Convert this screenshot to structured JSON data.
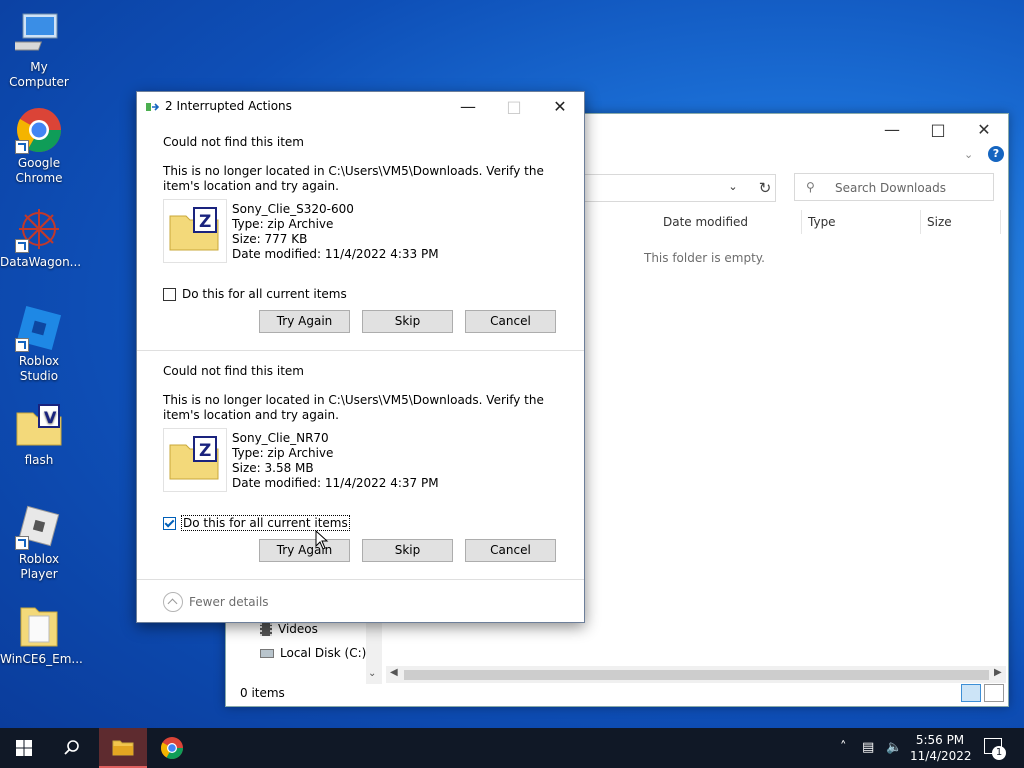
{
  "desktop": {
    "icons": [
      {
        "label": "My Computer"
      },
      {
        "label": "Google Chrome"
      },
      {
        "label": "DataWagon..."
      },
      {
        "label": "Roblox Studio"
      },
      {
        "label": "flash"
      },
      {
        "label": "Roblox Player"
      },
      {
        "label": "WinCE6_Em..."
      }
    ]
  },
  "explorer": {
    "search_placeholder": "Search Downloads",
    "columns": [
      "Date modified",
      "Type",
      "Size"
    ],
    "empty_message": "This folder is empty.",
    "nav_items": [
      "Videos",
      "Local Disk (C:)"
    ],
    "status": "0 items"
  },
  "dialog": {
    "title": "2 Interrupted Actions",
    "items": [
      {
        "heading": "Could not find this item",
        "message": "This is no longer located in C:\\Users\\VM5\\Downloads. Verify the item's location and try again.",
        "file_name": "Sony_Clie_S320-600",
        "file_type": "Type: zip Archive",
        "file_size": "Size: 777 KB",
        "file_date": "Date modified: 11/4/2022 4:33 PM",
        "checkbox_label": "Do this for all current items",
        "checked": false
      },
      {
        "heading": "Could not find this item",
        "message": "This is no longer located in C:\\Users\\VM5\\Downloads. Verify the item's location and try again.",
        "file_name": "Sony_Clie_NR70",
        "file_type": "Type: zip Archive",
        "file_size": "Size: 3.58 MB",
        "file_date": "Date modified: 11/4/2022 4:37 PM",
        "checkbox_label": "Do this for all current items",
        "checked": true
      }
    ],
    "buttons": {
      "try_again": "Try Again",
      "skip": "Skip",
      "cancel": "Cancel"
    },
    "fewer_details": "Fewer details"
  },
  "taskbar": {
    "time": "5:56 PM",
    "date": "11/4/2022",
    "notification_count": "1"
  },
  "colors": {
    "accent": "#005fb8",
    "taskbar": "#101826",
    "desktop": "#1b6fd6"
  }
}
